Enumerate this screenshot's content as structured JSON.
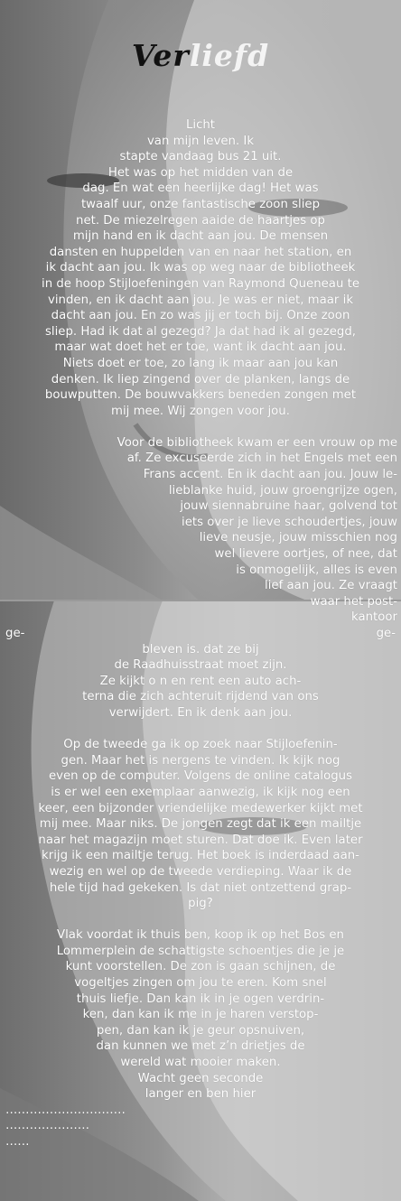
{
  "title": {
    "part1": "Ver",
    "part2": "liefd"
  },
  "poem": {
    "lines": [
      {
        "t": "Licht",
        "a": "c"
      },
      {
        "t": "van mijn leven. Ik",
        "a": "c"
      },
      {
        "t": "stapte vandaag bus 21 uit.",
        "a": "c"
      },
      {
        "t": "Het was op het midden van de",
        "a": "c"
      },
      {
        "t": "dag. En wat een heerlijke dag! Het was",
        "a": "c"
      },
      {
        "t": "twaalf uur, onze fantastische zoon sliep",
        "a": "c"
      },
      {
        "t": "net. De miezelregen aaide de haartjes op",
        "a": "c"
      },
      {
        "t": "mijn hand en ik dacht aan jou. De mensen",
        "a": "c"
      },
      {
        "t": "dansten en huppelden van en naar het station, en",
        "a": "c"
      },
      {
        "t": "ik dacht aan jou. Ik was op weg naar de bibliotheek",
        "a": "c"
      },
      {
        "t": "in de hoop Stijloefeningen van Raymond Queneau te",
        "a": "c"
      },
      {
        "t": "vinden, en ik dacht aan jou. Je was er niet, maar ik",
        "a": "c"
      },
      {
        "t": "dacht aan jou. En zo was jij er toch bij. Onze zoon",
        "a": "c"
      },
      {
        "t": "sliep. Had ik dat al gezegd? Ja dat had ik al gezegd,",
        "a": "c"
      },
      {
        "t": "maar wat doet het er toe, want ik dacht aan jou.",
        "a": "c"
      },
      {
        "t": "Niets doet er toe, zo lang ik maar aan jou kan",
        "a": "c"
      },
      {
        "t": "denken. Ik liep zingend over de planken, langs de",
        "a": "c"
      },
      {
        "t": "bouwputten. De bouwvakkers beneden zongen met",
        "a": "c"
      },
      {
        "t": "mij mee. Wij zongen voor jou.",
        "a": "c"
      },
      {
        "t": "",
        "a": "gap"
      },
      {
        "t": "Voor de bibliotheek kwam er een vrouw op me",
        "a": "r"
      },
      {
        "t": "af. Ze excuseerde zich in het Engels met een",
        "a": "r"
      },
      {
        "t": "Frans accent. En ik dacht aan jou. Jouw le-",
        "a": "r"
      },
      {
        "t": "lieblanke huid, jouw groengrijze ogen,",
        "a": "r"
      },
      {
        "t": "jouw siennabruine haar, golvend tot",
        "a": "r"
      },
      {
        "t": "iets over je lieve schoudertjes, jouw",
        "a": "r"
      },
      {
        "t": "lieve neusje, jouw misschien nog",
        "a": "r"
      },
      {
        "t": "wel lievere oortjes, of nee, dat",
        "a": "r"
      },
      {
        "t": "is onmogelijk, alles is even",
        "a": "r"
      },
      {
        "t": "lief aan jou. Ze vraagt",
        "a": "r"
      },
      {
        "t": "waar het post-",
        "a": "r"
      },
      {
        "t": "kantoor",
        "a": "r"
      },
      {
        "t": "ge-|ge-",
        "a": "j"
      },
      {
        "t": "bleven is. dat ze bij",
        "a": "c"
      },
      {
        "t": "de Raadhuisstraat moet zijn.",
        "a": "c"
      },
      {
        "t": "Ze kijkt o n en rent een auto ach-",
        "a": "c"
      },
      {
        "t": "terna die zich achteruit rijdend van ons",
        "a": "c"
      },
      {
        "t": "verwijdert. En ik denk aan jou.",
        "a": "c"
      },
      {
        "t": "",
        "a": "gap"
      },
      {
        "t": "Op de tweede ga ik op zoek naar Stijloefenin-",
        "a": "c"
      },
      {
        "t": "gen. Maar het is nergens te vinden. Ik kijk nog",
        "a": "c"
      },
      {
        "t": "even op de computer. Volgens de online catalogus",
        "a": "c"
      },
      {
        "t": "is er wel een exemplaar aanwezig, ik kijk nog een",
        "a": "c"
      },
      {
        "t": "keer, een bijzonder vriendelijke medewerker kijkt met",
        "a": "c"
      },
      {
        "t": "mij mee. Maar niks. De jongen zegt dat ik een mailtje",
        "a": "c"
      },
      {
        "t": "naar het magazijn moet sturen. Dat doe ik. Even later",
        "a": "c"
      },
      {
        "t": "krijg ik een mailtje terug. Het boek is inderdaad aan-",
        "a": "c"
      },
      {
        "t": "wezig en wel op de tweede verdieping. Waar ik de",
        "a": "c"
      },
      {
        "t": "hele tijd had gekeken. Is dat niet ontzettend grap-",
        "a": "c"
      },
      {
        "t": "pig?",
        "a": "c"
      },
      {
        "t": "",
        "a": "gap"
      },
      {
        "t": "Vlak voordat ik thuis ben, koop ik op het Bos en",
        "a": "c"
      },
      {
        "t": "Lommerplein de schattigste schoentjes die je je",
        "a": "c"
      },
      {
        "t": "kunt voorstellen. De zon is gaan schijnen, de",
        "a": "c"
      },
      {
        "t": "vogeltjes zingen om jou te eren. Kom snel",
        "a": "c"
      },
      {
        "t": "thuis liefje. Dan kan ik in je ogen verdrin-",
        "a": "c"
      },
      {
        "t": "ken, dan kan ik me in je haren verstop-",
        "a": "c"
      },
      {
        "t": "pen, dan kan ik je geur opsnuiven,",
        "a": "c"
      },
      {
        "t": "dan kunnen we met z’n drietjes de",
        "a": "c"
      },
      {
        "t": "wereld wat mooier maken.",
        "a": "c"
      },
      {
        "t": "Wacht geen seconde",
        "a": "c"
      },
      {
        "t": "langer en ben hier",
        "a": "c"
      },
      {
        "t": "…………………………",
        "a": "l"
      },
      {
        "t": "…………………",
        "a": "l"
      },
      {
        "t": "……",
        "a": "l"
      }
    ]
  }
}
